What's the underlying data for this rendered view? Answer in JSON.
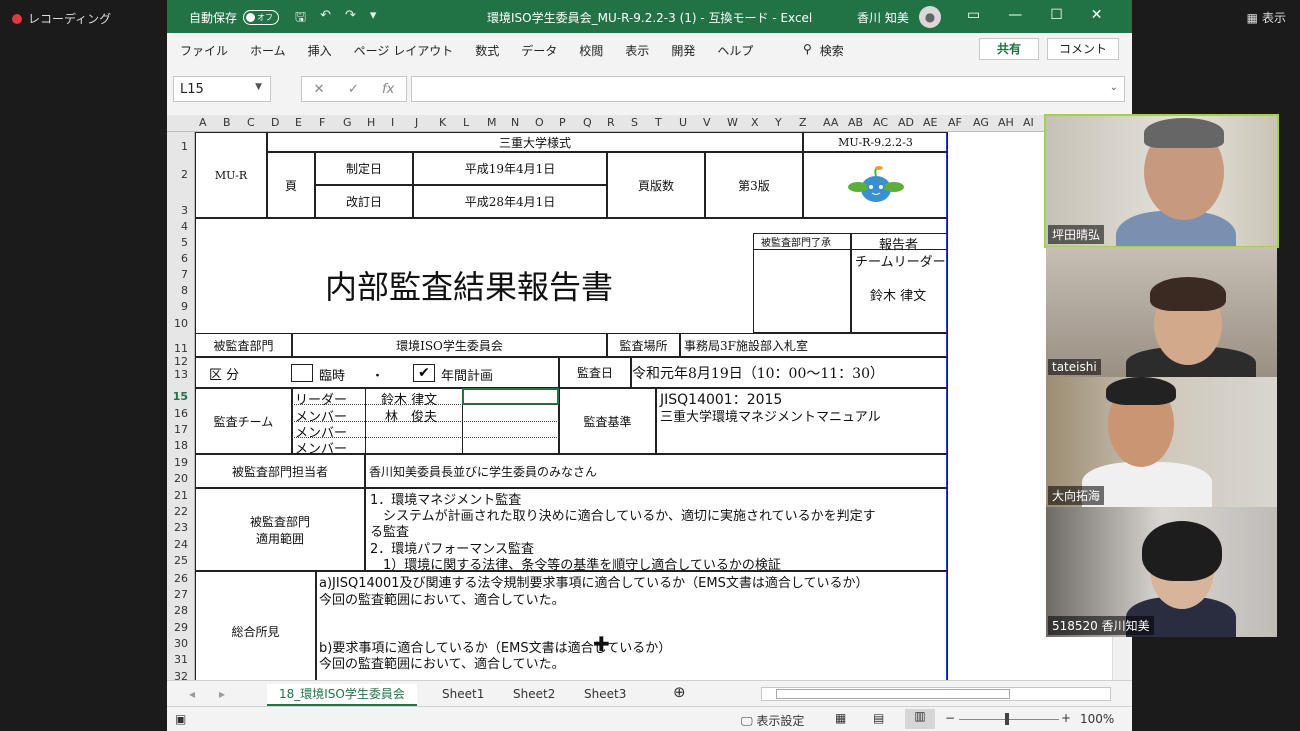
{
  "zoom": {
    "recording_label": "レコーディング",
    "view_label": "表示"
  },
  "excel": {
    "autosave_label": "自動保存",
    "autosave_state": "オフ",
    "doc_title": "環境ISO学生委員会_MU-R-9.2.2-3 (1)  -  互換モード  -  Excel",
    "user_name": "香川 知美",
    "menu": [
      "ファイル",
      "ホーム",
      "挿入",
      "ページ レイアウト",
      "数式",
      "データ",
      "校閲",
      "表示",
      "開発",
      "ヘルプ"
    ],
    "search_label": "検索",
    "share_label": "共有",
    "comment_label": "コメント",
    "name_box": "L15",
    "columns": [
      "A",
      "B",
      "C",
      "D",
      "E",
      "F",
      "G",
      "H",
      "I",
      "J",
      "K",
      "L",
      "M",
      "N",
      "O",
      "P",
      "Q",
      "R",
      "S",
      "T",
      "U",
      "V",
      "W",
      "X",
      "Y",
      "Z",
      "AA",
      "AB",
      "AC",
      "AD",
      "AE",
      "AF",
      "AG",
      "AH",
      "AI"
    ],
    "rows": [
      "1",
      "2",
      "3",
      "4",
      "5",
      "6",
      "7",
      "8",
      "9",
      "10",
      "11",
      "12",
      "13",
      "15",
      "16",
      "17",
      "18",
      "19",
      "20",
      "21",
      "22",
      "23",
      "24",
      "25",
      "26",
      "27",
      "28",
      "29",
      "30",
      "31",
      "32"
    ],
    "tabs": [
      "18_環境ISO学生委員会",
      "Sheet1",
      "Sheet2",
      "Sheet3"
    ],
    "status_display_settings": "表示設定",
    "zoom_level": "100%"
  },
  "form": {
    "university_style": "三重大学様式",
    "form_code": "MU-R-9.2.2-3",
    "mu_r": "MU-R",
    "page_label": "頁",
    "established_label": "制定日",
    "established_date": "平成19年4月1日",
    "revised_label": "改訂日",
    "revised_date": "平成28年4月1日",
    "edition_label": "頁版数",
    "edition": "第3版",
    "title": "内部監査結果報告書",
    "approval_label": "被監査部門了承",
    "reporter_label": "報告者",
    "team_leader_label": "チームリーダー",
    "team_leader_name": "鈴木 律文",
    "audited_dept_label": "被監査部門",
    "audited_dept": "環境ISO学生委員会",
    "audit_place_label": "監査場所",
    "audit_place": "事務局3F施設部入札室",
    "category_label": "区 分",
    "temporary_label": "臨時",
    "dot": "・",
    "annual_label": "年間計画",
    "annual_checked": "✔",
    "audit_date_label": "監査日",
    "audit_date": "令和元年8月19日（10：00～11：30）",
    "team_label": "監査チーム",
    "leader_role": "リーダー",
    "leader_name": "鈴木 律文",
    "member_role": "メンバー",
    "member1_name": "林　俊夫",
    "criteria_label": "監査基準",
    "criteria_1": "JISQ14001：2015",
    "criteria_2": "三重大学環境マネジメントマニュアル",
    "contact_label": "被監査部門担当者",
    "contact_value": "香川知美委員長並びに学生委員のみなさん",
    "scope_label_1": "被監査部門",
    "scope_label_2": "適用範囲",
    "scope_1": "1．環境マネジメント監査",
    "scope_2": "　システムが計画された取り決めに適合しているか、適切に実施されているかを判定す",
    "scope_3": "る監査",
    "scope_4": "2．環境パフォーマンス監査",
    "scope_5": "　1）環境に関する法律、条令等の基準を順守し適合しているかの検証",
    "overall_label": "総合所見",
    "overall_a": "a)JISQ14001及び関連する法令規制要求事項に適合しているか（EMS文書は適合しているか）",
    "overall_a_result": "今回の監査範囲において、適合していた。",
    "overall_b": "b)要求事項に適合しているか（EMS文書は適合しているか）",
    "overall_b_result": "今回の監査範囲において、適合していた。"
  },
  "participants": [
    {
      "name": "坪田晴弘",
      "active": true
    },
    {
      "name": "tateishi",
      "active": false
    },
    {
      "name": "大向拓海",
      "active": false
    },
    {
      "name": "518520 香川知美",
      "active": false
    }
  ],
  "colors": {
    "excel_green": "#217346",
    "active_speaker": "#9fd44a",
    "sheet_border": "#2a3fd4"
  }
}
